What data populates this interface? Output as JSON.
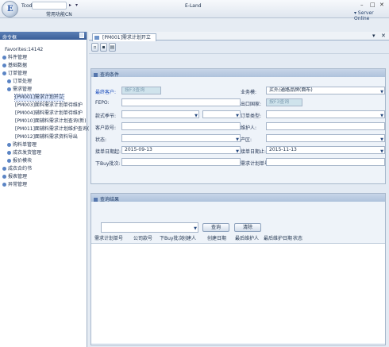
{
  "app": {
    "title": "E-Land",
    "tcode_label": "Tcode",
    "menu": "常用功能CN",
    "server": "Server Online"
  },
  "left": {
    "header": "命令框",
    "items": [
      {
        "label": "Favorites:14142"
      },
      {
        "label": "料件管理"
      },
      {
        "label": "基础数据"
      },
      {
        "label": "订单管理"
      },
      {
        "label": "订单处理"
      },
      {
        "label": "需求管理"
      },
      {
        "label": "[PM001]需求计划开立"
      },
      {
        "label": "[PM003]面料需求计划单待维护"
      },
      {
        "label": "[PM004]辅料需求计划单待维护"
      },
      {
        "label": "[PM010]面辅料需求计划查询(新)"
      },
      {
        "label": "[PM011]面辅料需求计划维护查询(新)"
      },
      {
        "label": "[PM012]面辅料需求资料导出"
      },
      {
        "label": "购料单管理"
      },
      {
        "label": "成衣发货管理"
      },
      {
        "label": "报价模块"
      },
      {
        "label": "成衣合约书"
      },
      {
        "label": "报表管理"
      },
      {
        "label": "异常管理"
      }
    ]
  },
  "tab": {
    "label": "[PM001]需求计划开立"
  },
  "query": {
    "header": "查询条件",
    "fields": {
      "customer": {
        "label": "最终客户:",
        "placeholder": "按F3查询"
      },
      "biz_mode": {
        "label": "业务模:",
        "value": "买外/通路品牌(面布)"
      },
      "fepo": {
        "label": "FEPO:"
      },
      "ship_country": {
        "label": "出口国家:",
        "placeholder": "按F3查询"
      },
      "season": {
        "label": "款式季节:"
      },
      "order_type": {
        "label": "订单类型:"
      },
      "cust_style": {
        "label": "客户款号:"
      },
      "maintainer": {
        "label": "维护人:"
      },
      "status": {
        "label": "状态:"
      },
      "factory": {
        "label": "产区:"
      },
      "date_from": {
        "label": "接单日期起:",
        "value": "2015-09-13"
      },
      "date_to": {
        "label": "接单日期止:",
        "value": "2015-11-13"
      },
      "buy_batch": {
        "label": "下Buy批次:"
      },
      "req_no": {
        "label": "需求计划单号:"
      }
    }
  },
  "results": {
    "header": "查询结果",
    "query_btn": "查询",
    "clear_btn": "清除",
    "columns": [
      "需求计划单号",
      "公司款号",
      "下Buy批次",
      "创建人",
      "创建日期",
      "最后维护人",
      "最后维护日期",
      "状态"
    ]
  }
}
